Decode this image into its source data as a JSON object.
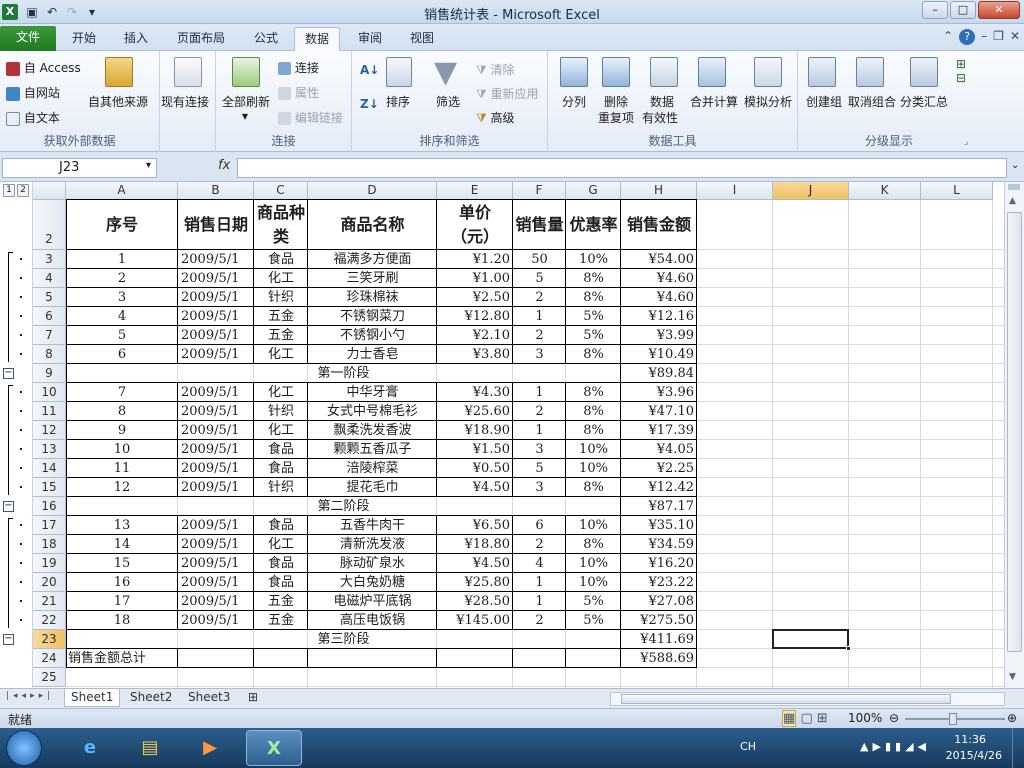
{
  "window": {
    "title": "销售统计表 - Microsoft Excel",
    "qat_icons": [
      "excel-app-icon",
      "save-icon",
      "undo-icon",
      "redo-icon",
      "customize-qat-icon"
    ],
    "controls": {
      "minimize": "–",
      "maximize": "□",
      "close": "✕"
    }
  },
  "ribbon_tabs": [
    "文件",
    "开始",
    "插入",
    "页面布局",
    "公式",
    "数据",
    "审阅",
    "视图"
  ],
  "active_tab": "数据",
  "ribbon": {
    "groups": {
      "external": "获取外部数据",
      "connections": "连接",
      "sortfilter": "排序和筛选",
      "datatools": "数据工具",
      "outline": "分级显示"
    },
    "external": {
      "access": "自 Access",
      "web": "自网站",
      "text": "自文本",
      "other": "自其他来源",
      "existing": "现有连接"
    },
    "connections": {
      "refresh_all": "全部刷新",
      "connections": "连接",
      "properties": "属性",
      "edit_links": "编辑链接"
    },
    "sortfilter": {
      "sort": "排序",
      "filter": "筛选",
      "clear": "清除",
      "reapply": "重新应用",
      "advanced": "高级"
    },
    "datatools": {
      "text_to_columns": "分列",
      "remove_dup_1": "删除",
      "remove_dup_2": "重复项",
      "validation_1": "数据",
      "validation_2": "有效性",
      "consolidate": "合并计算",
      "whatif": "模拟分析"
    },
    "outline": {
      "group": "创建组",
      "ungroup": "取消组合",
      "subtotal": "分类汇总"
    }
  },
  "formula_bar": {
    "name_box": "J23",
    "fx": "fx",
    "content": ""
  },
  "columns": [
    "A",
    "B",
    "C",
    "D",
    "E",
    "F",
    "G",
    "H",
    "I",
    "J",
    "K",
    "L"
  ],
  "selected_cell": {
    "column": "J",
    "row": "23"
  },
  "outline_levels": [
    "1",
    "2"
  ],
  "headers": {
    "row_number": "2",
    "cells": [
      "序号",
      "销售日期",
      "商品种类",
      "商品名称",
      "单价（元）",
      "销售量",
      "优惠率",
      "销售金额"
    ]
  },
  "top_row_number": "1",
  "rows": [
    {
      "n": "3",
      "c": [
        "1",
        "2009/5/1",
        "食品",
        "福满多方便面",
        "¥1.20",
        "50",
        "10%",
        "¥54.00"
      ]
    },
    {
      "n": "4",
      "c": [
        "2",
        "2009/5/1",
        "化工",
        "三笑牙刷",
        "¥1.00",
        "5",
        "8%",
        "¥4.60"
      ]
    },
    {
      "n": "5",
      "c": [
        "3",
        "2009/5/1",
        "针织",
        "珍珠棉袜",
        "¥2.50",
        "2",
        "8%",
        "¥4.60"
      ]
    },
    {
      "n": "6",
      "c": [
        "4",
        "2009/5/1",
        "五金",
        "不锈钢菜刀",
        "¥12.80",
        "1",
        "5%",
        "¥12.16"
      ]
    },
    {
      "n": "7",
      "c": [
        "5",
        "2009/5/1",
        "五金",
        "不锈钢小勺",
        "¥2.10",
        "2",
        "5%",
        "¥3.99"
      ]
    },
    {
      "n": "8",
      "c": [
        "6",
        "2009/5/1",
        "化工",
        "力士香皂",
        "¥3.80",
        "3",
        "8%",
        "¥10.49"
      ]
    },
    {
      "n": "9",
      "sub": "第一阶段",
      "total": "¥89.84"
    },
    {
      "n": "10",
      "c": [
        "7",
        "2009/5/1",
        "化工",
        "中华牙膏",
        "¥4.30",
        "1",
        "8%",
        "¥3.96"
      ]
    },
    {
      "n": "11",
      "c": [
        "8",
        "2009/5/1",
        "针织",
        "女式中号棉毛衫",
        "¥25.60",
        "2",
        "8%",
        "¥47.10"
      ]
    },
    {
      "n": "12",
      "c": [
        "9",
        "2009/5/1",
        "化工",
        "飘柔洗发香波",
        "¥18.90",
        "1",
        "8%",
        "¥17.39"
      ]
    },
    {
      "n": "13",
      "c": [
        "10",
        "2009/5/1",
        "食品",
        "颗颗五香瓜子",
        "¥1.50",
        "3",
        "10%",
        "¥4.05"
      ]
    },
    {
      "n": "14",
      "c": [
        "11",
        "2009/5/1",
        "食品",
        "涪陵榨菜",
        "¥0.50",
        "5",
        "10%",
        "¥2.25"
      ]
    },
    {
      "n": "15",
      "c": [
        "12",
        "2009/5/1",
        "针织",
        "提花毛巾",
        "¥4.50",
        "3",
        "8%",
        "¥12.42"
      ]
    },
    {
      "n": "16",
      "sub": "第二阶段",
      "total": "¥87.17"
    },
    {
      "n": "17",
      "c": [
        "13",
        "2009/5/1",
        "食品",
        "五香牛肉干",
        "¥6.50",
        "6",
        "10%",
        "¥35.10"
      ]
    },
    {
      "n": "18",
      "c": [
        "14",
        "2009/5/1",
        "化工",
        "清新洗发液",
        "¥18.80",
        "2",
        "8%",
        "¥34.59"
      ]
    },
    {
      "n": "19",
      "c": [
        "15",
        "2009/5/1",
        "食品",
        "脉动矿泉水",
        "¥4.50",
        "4",
        "10%",
        "¥16.20"
      ]
    },
    {
      "n": "20",
      "c": [
        "16",
        "2009/5/1",
        "食品",
        "大白兔奶糖",
        "¥25.80",
        "1",
        "10%",
        "¥23.22"
      ]
    },
    {
      "n": "21",
      "c": [
        "17",
        "2009/5/1",
        "五金",
        "电磁炉平底锅",
        "¥28.50",
        "1",
        "5%",
        "¥27.08"
      ]
    },
    {
      "n": "22",
      "c": [
        "18",
        "2009/5/1",
        "五金",
        "高压电饭锅",
        "¥145.00",
        "2",
        "5%",
        "¥275.50"
      ]
    },
    {
      "n": "23",
      "sub": "第三阶段",
      "total": "¥411.69"
    },
    {
      "n": "24",
      "grand": "销售金额总计",
      "total": "¥588.69"
    },
    {
      "n": "25",
      "empty": true
    }
  ],
  "sheets": [
    "Sheet1",
    "Sheet2",
    "Sheet3"
  ],
  "active_sheet": "Sheet1",
  "status": {
    "ready": "就绪",
    "zoom": "100%"
  },
  "taskbar": {
    "ime": "CH",
    "time": "11:36",
    "date": "2015/4/26"
  }
}
